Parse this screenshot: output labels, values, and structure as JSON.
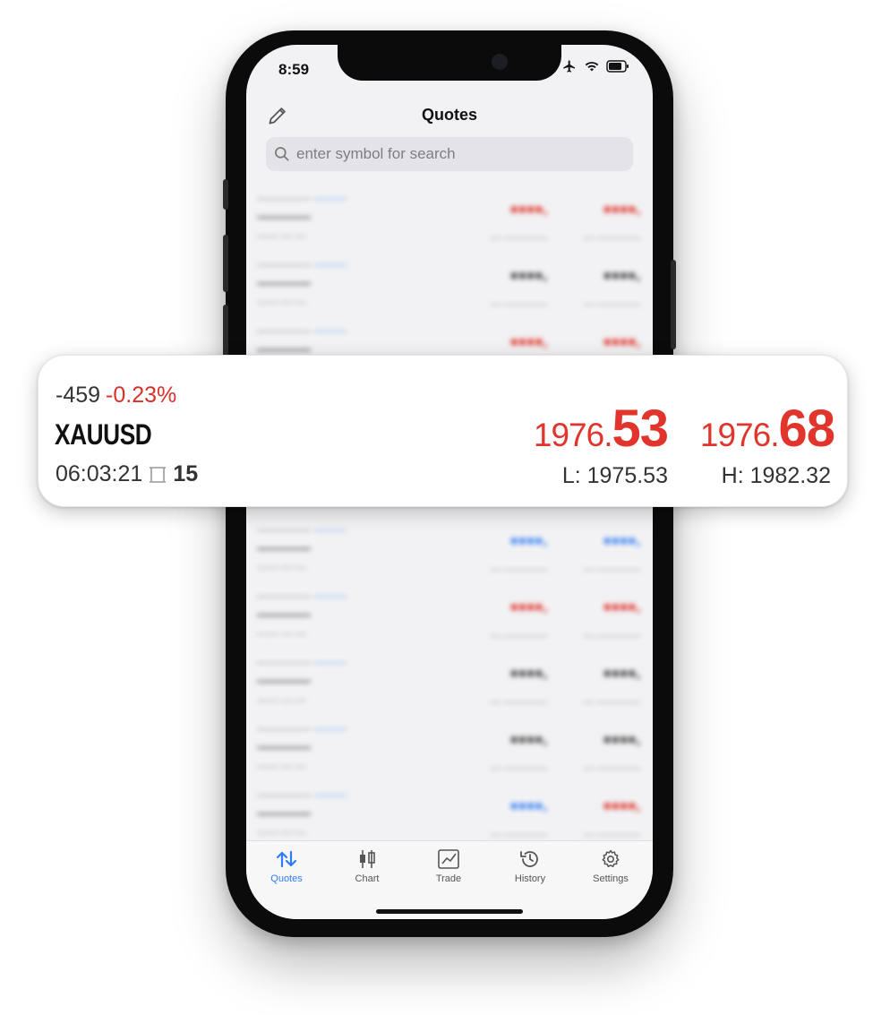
{
  "status_bar": {
    "time": "8:59"
  },
  "header": {
    "title": "Quotes"
  },
  "search": {
    "placeholder": "enter symbol for search"
  },
  "tabs": [
    {
      "label": "Quotes",
      "icon": "quotes-arrows-icon",
      "active": true
    },
    {
      "label": "Chart",
      "icon": "candlestick-chart-icon",
      "active": false
    },
    {
      "label": "Trade",
      "icon": "trade-chart-icon",
      "active": false
    },
    {
      "label": "History",
      "icon": "history-clock-icon",
      "active": false
    },
    {
      "label": "Settings",
      "icon": "gear-icon",
      "active": false
    }
  ],
  "highlight": {
    "change_points": "-459",
    "change_percent": "-0.23%",
    "symbol": "XAUUSD",
    "time": "06:03:21",
    "spread": "15",
    "bid_base": "1976.",
    "bid_big": "53",
    "ask_base": "1976.",
    "ask_big": "68",
    "low": "L: 1975.53",
    "high": "H: 1982.32"
  },
  "colors": {
    "accent": "#2f7cf6",
    "down": "#e0342c",
    "up": "#3b82f6"
  }
}
